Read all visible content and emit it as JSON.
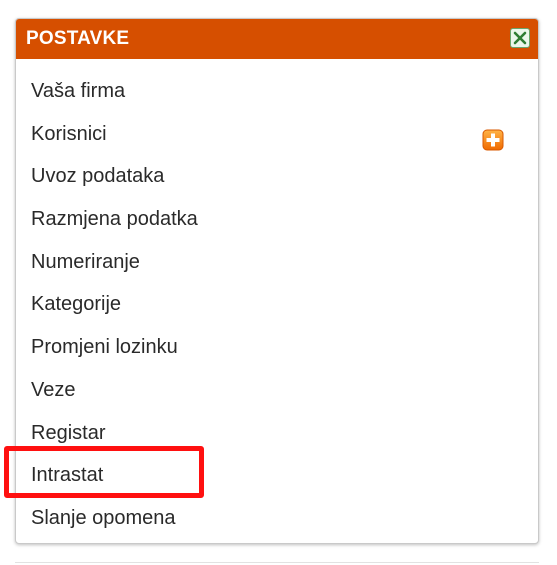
{
  "panel": {
    "title": "POSTAVKE",
    "header_color": "#d64f00",
    "close_icon": "close-icon"
  },
  "menu": {
    "items": [
      {
        "label": "Vaša firma"
      },
      {
        "label": "Korisnici",
        "action_icon": "add-icon"
      },
      {
        "label": "Uvoz podataka"
      },
      {
        "label": "Razmjena podatka"
      },
      {
        "label": "Numeriranje"
      },
      {
        "label": "Kategorije"
      },
      {
        "label": "Promjeni lozinku"
      },
      {
        "label": "Veze"
      },
      {
        "label": "Registar"
      },
      {
        "label": "Intrastat",
        "highlighted": true
      },
      {
        "label": "Slanje opomena"
      }
    ]
  },
  "highlight": {
    "color": "#ff1010",
    "target": "Intrastat"
  }
}
